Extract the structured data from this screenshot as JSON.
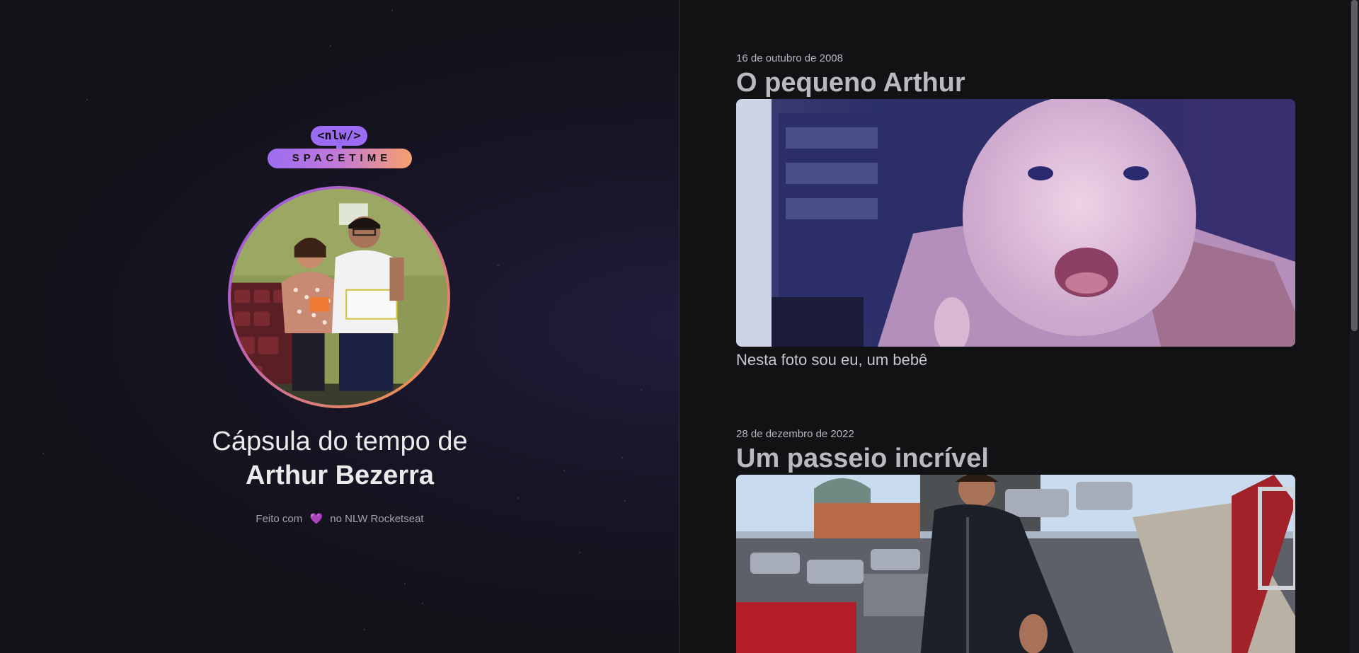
{
  "brand": {
    "logo_top": "<nlw/>",
    "logo_bottom": "SPACETIME"
  },
  "profile": {
    "title_prefix": "Cápsula do tempo de",
    "name": "Arthur Bezerra",
    "avatar_icon": "user-photo"
  },
  "footer": {
    "text_before": "Feito com",
    "heart": "💜",
    "text_after": "no NLW Rocketseat"
  },
  "memories": [
    {
      "date": "16 de outubro de 2008",
      "title": "O pequeno Arthur",
      "caption": "Nesta foto sou eu, um bebê"
    },
    {
      "date": "28 de dezembro de 2022",
      "title": "Um passeio incrível",
      "caption": ""
    }
  ],
  "colors": {
    "accent_purple": "#9b6cf3",
    "accent_orange": "#f39a3a",
    "background": "#121215"
  }
}
